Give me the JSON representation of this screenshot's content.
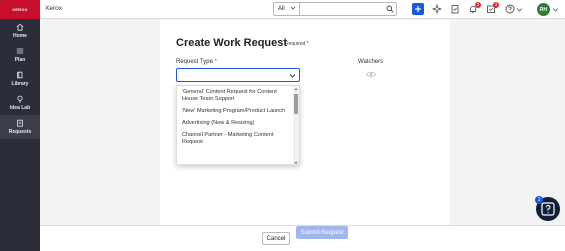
{
  "nav": {
    "logo": "XEROX",
    "items": [
      {
        "label": "Home",
        "icon": "home-icon"
      },
      {
        "label": "Plan",
        "icon": "list-icon"
      },
      {
        "label": "Library",
        "icon": "book-icon"
      },
      {
        "label": "Idea Lab",
        "icon": "lightbulb-icon"
      },
      {
        "label": "Requests",
        "icon": "clipboard-icon"
      }
    ]
  },
  "topbar": {
    "company": "Xerox",
    "search_scope": "All",
    "search_placeholder": "",
    "notifications_count": "2",
    "tasks_count": "3",
    "avatar_initials": "RH"
  },
  "form": {
    "title": "Create Work Request",
    "required_note": "Required *",
    "request_type_label": "Request Type",
    "required_star": "*",
    "request_type_value": "",
    "watchers_label": "Watchers",
    "options": [
      "'General' Content Request for Content House Team Support",
      "'New' Marketing Program/Product Launch",
      "Advertising (New & Resizing)",
      "Channel Partner - Marketing Content Request"
    ]
  },
  "footer": {
    "cancel_label": "Cancel",
    "submit_label": "Submit Request"
  },
  "help": {
    "badge": "1"
  },
  "colors": {
    "accent": "#1a56e0",
    "nav_bg": "#2b2d3a",
    "brand": "#c8102e",
    "avatar": "#2e7d32"
  }
}
